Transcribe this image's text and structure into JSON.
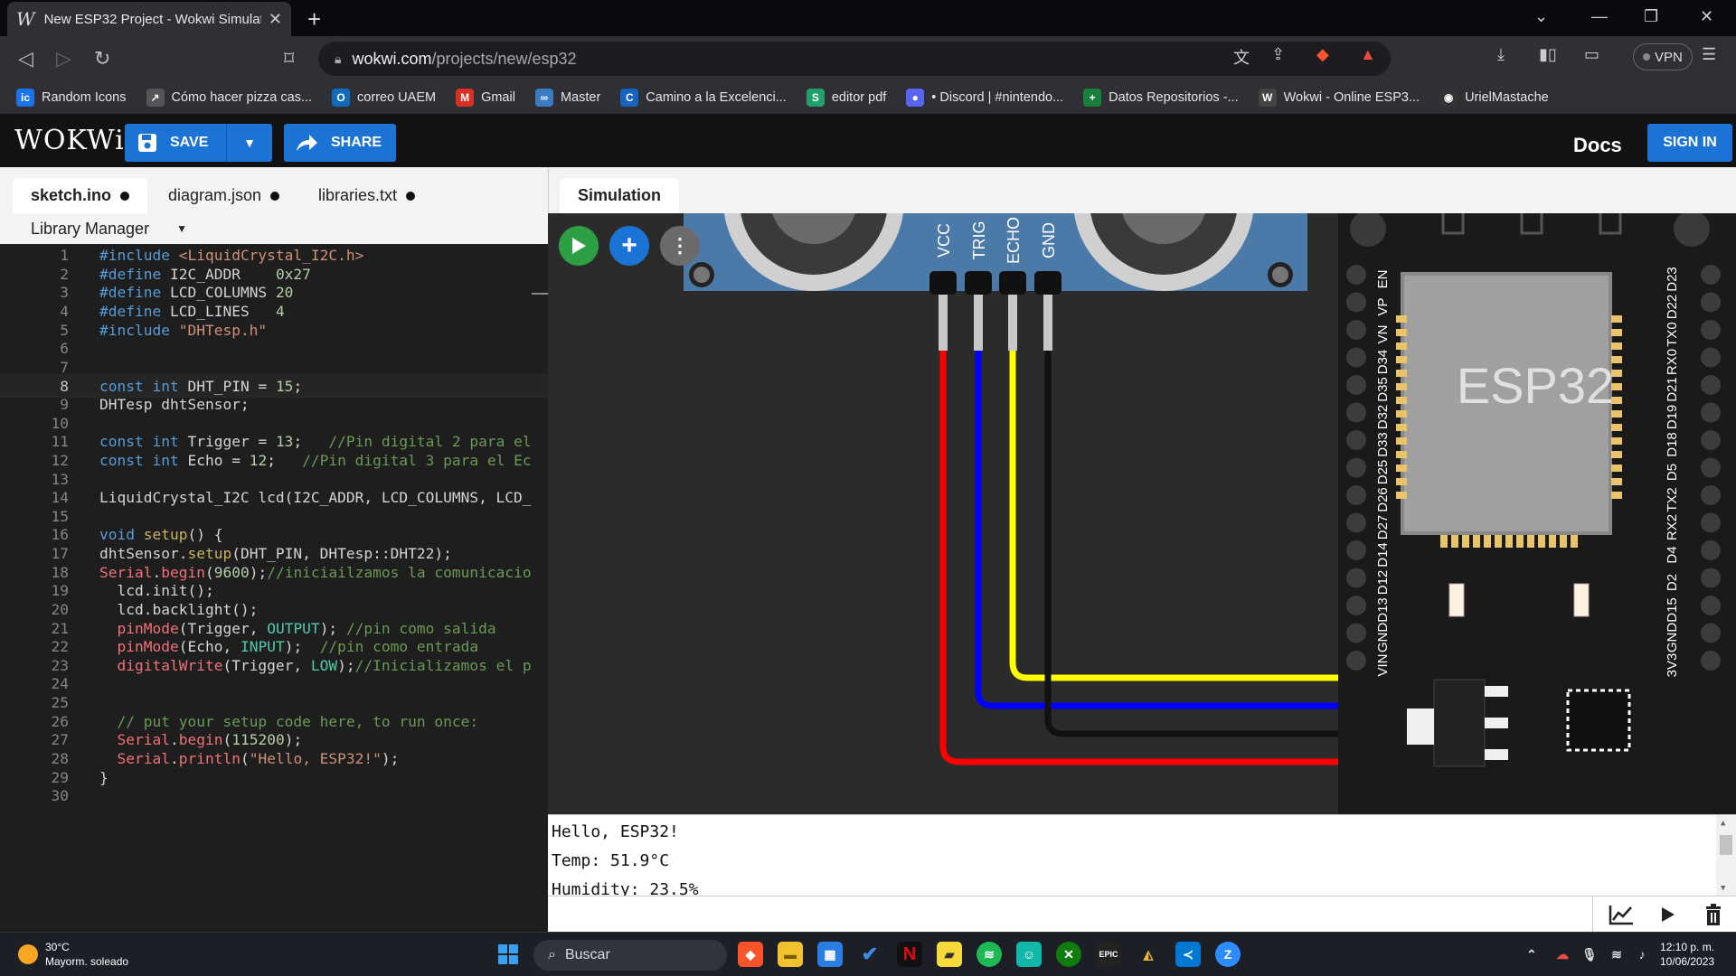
{
  "browser": {
    "tab_title": "New ESP32 Project - Wokwi Simulato",
    "tab_icon": "W",
    "url_host": "wokwi.com",
    "url_path": "/projects/new/esp32",
    "vpn_label": "VPN",
    "bookmarks": [
      {
        "label": "Random Icons",
        "icon": "ic",
        "color": "#1a73e8"
      },
      {
        "label": "Cómo hacer pizza cas...",
        "icon": "↗",
        "color": "#555"
      },
      {
        "label": "correo UAEM",
        "icon": "O",
        "color": "#0f6cbd"
      },
      {
        "label": "Gmail",
        "icon": "M",
        "color": "#d93025"
      },
      {
        "label": "Master",
        "icon": "∞",
        "color": "#3b7bbf"
      },
      {
        "label": "Camino a la Excelenci...",
        "icon": "C",
        "color": "#1565c0"
      },
      {
        "label": "editor pdf",
        "icon": "S",
        "color": "#22a06b"
      },
      {
        "label": "• Discord | #nintendo...",
        "icon": "●",
        "color": "#5865f2"
      },
      {
        "label": "Datos Repositorios -...",
        "icon": "+",
        "color": "#188038"
      },
      {
        "label": "Wokwi - Online ESP3...",
        "icon": "W",
        "color": "#444"
      },
      {
        "label": "UrielMastache",
        "icon": "◉",
        "color": "#333"
      }
    ]
  },
  "wokwi": {
    "logo": "WOKWi",
    "save_label": "SAVE",
    "share_label": "SHARE",
    "docs_label": "Docs",
    "signin_label": "SIGN IN",
    "accent": "#1c73d6"
  },
  "editor": {
    "tabs": [
      {
        "label": "sketch.ino",
        "active": true
      },
      {
        "label": "diagram.json",
        "active": false
      },
      {
        "label": "libraries.txt",
        "active": false
      }
    ],
    "library_manager": "Library Manager",
    "current_line": 8
  },
  "simulation": {
    "tab_label": "Simulation",
    "sensor_pins": [
      "VCC",
      "TRIG",
      "ECHO",
      "GND"
    ],
    "board_label": "ESP32",
    "left_pins": [
      "EN",
      "VP",
      "VN",
      "D34",
      "D35",
      "D32",
      "D33",
      "D25",
      "D26",
      "D27",
      "D14",
      "D12",
      "D13",
      "GND",
      "VIN"
    ],
    "right_pins": [
      "D23",
      "D22",
      "TX0",
      "RX0",
      "D21",
      "D19",
      "D18",
      "D5",
      "TX2",
      "RX2",
      "D4",
      "D2",
      "D15",
      "GND",
      "3V3"
    ],
    "serial_lines": [
      "Hello, ESP32!",
      "Temp: 51.9°C",
      "Humidity: 23.5%"
    ]
  },
  "taskbar": {
    "temp": "30°C",
    "weather": "Mayorm. soleado",
    "search": "Buscar",
    "time": "12:10 p. m.",
    "date": "10/06/2023"
  }
}
